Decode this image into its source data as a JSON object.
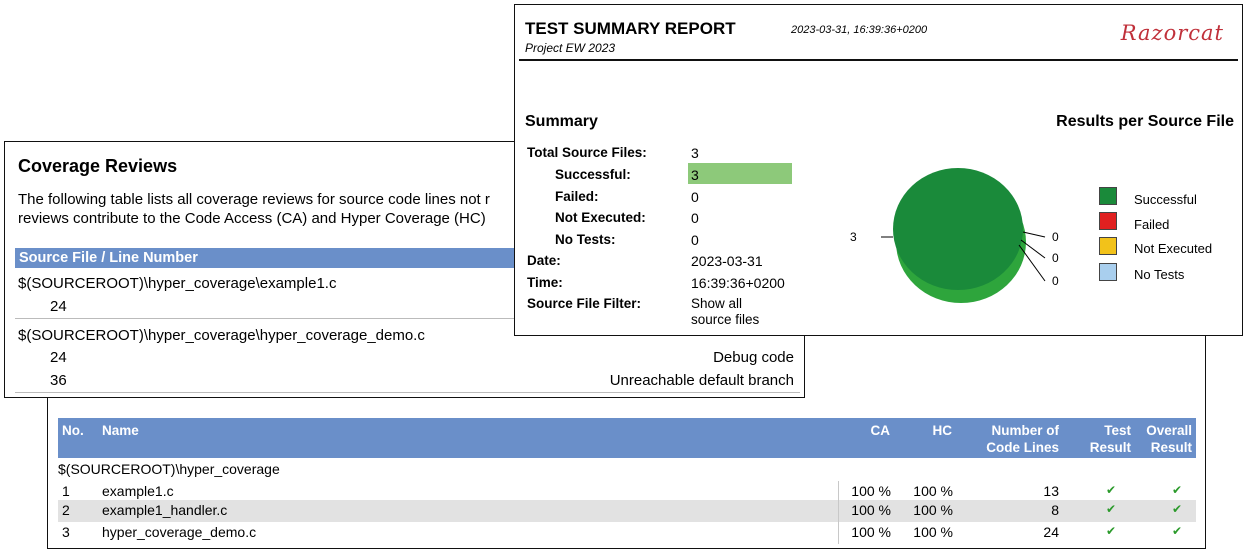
{
  "source_table": {
    "headers": {
      "no": "No.",
      "name": "Name",
      "ca": "CA",
      "hc": "HC",
      "lines_1": "Number of",
      "lines_2": "Code Lines",
      "test_1": "Test",
      "test_2": "Result",
      "overall_1": "Overall",
      "overall_2": "Result"
    },
    "group": "$(SOURCEROOT)\\hyper_coverage",
    "rows": [
      {
        "no": "1",
        "name": "example1.c",
        "ca": "100 %",
        "hc": "100 %",
        "lines": "13",
        "test": "✔",
        "overall": "✔"
      },
      {
        "no": "2",
        "name": "example1_handler.c",
        "ca": "100 %",
        "hc": "100 %",
        "lines": "8",
        "test": "✔",
        "overall": "✔"
      },
      {
        "no": "3",
        "name": "hyper_coverage_demo.c",
        "ca": "100 %",
        "hc": "100 %",
        "lines": "24",
        "test": "✔",
        "overall": "✔"
      }
    ]
  },
  "coverage_reviews": {
    "title": "Coverage Reviews",
    "desc_1": "The following table lists all coverage reviews for source code lines not r",
    "desc_2": "reviews contribute to the Code Access (CA) and Hyper Coverage (HC)",
    "header": "Source File / Line Number",
    "file_1": "$(SOURCEROOT)\\hyper_coverage\\example1.c",
    "file_1_line": "24",
    "file_2": "$(SOURCEROOT)\\hyper_coverage\\hyper_coverage_demo.c",
    "file_2_lines": [
      {
        "line": "24",
        "reason": "Debug code"
      },
      {
        "line": "36",
        "reason": "Unreachable default branch"
      }
    ]
  },
  "report": {
    "title": "TEST SUMMARY REPORT",
    "project": "Project EW 2023",
    "timestamp": "2023-03-31, 16:39:36+0200",
    "logo": "Razorcat",
    "summary_heading": "Summary",
    "results_heading": "Results per Source File",
    "fields": {
      "total_label": "Total Source Files:",
      "total_value": "3",
      "successful_label": "Successful:",
      "successful_value": "3",
      "failed_label": "Failed:",
      "failed_value": "0",
      "notexec_label": "Not Executed:",
      "notexec_value": "0",
      "notests_label": "No Tests:",
      "notests_value": "0",
      "date_label": "Date:",
      "date_value": "2023-03-31",
      "time_label": "Time:",
      "time_value": "16:39:36+0200",
      "filter_label": "Source File Filter:",
      "filter_value_1": "Show all",
      "filter_value_2": "source files"
    }
  },
  "chart_data": {
    "type": "pie",
    "categories": [
      "Successful",
      "Failed",
      "Not Executed",
      "No Tests"
    ],
    "values": [
      3,
      0,
      0,
      0
    ],
    "colors": [
      "#1a8a3a",
      "#e02020",
      "#f2c21a",
      "#a9cfee"
    ],
    "slice_labels": [
      "3",
      "0",
      "0",
      "0"
    ]
  }
}
